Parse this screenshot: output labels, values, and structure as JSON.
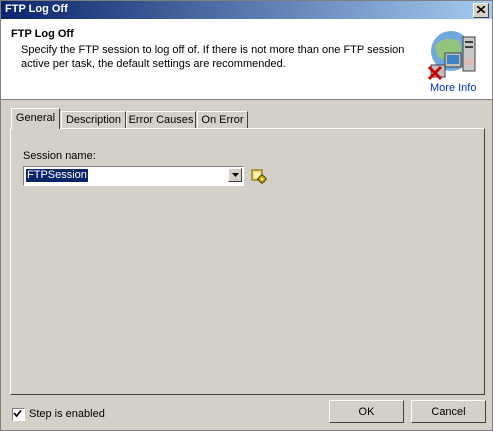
{
  "window": {
    "title": "FTP Log Off"
  },
  "header": {
    "title": "FTP Log Off",
    "description_line1": "Specify the FTP session to log off of.  If there is not more than one FTP session",
    "description_line2": "active per task, the default settings are recommended.",
    "more_info_label": "More Info"
  },
  "tabs": [
    {
      "label": "General",
      "active": true
    },
    {
      "label": "Description",
      "active": false
    },
    {
      "label": "Error Causes",
      "active": false
    },
    {
      "label": "On Error",
      "active": false
    }
  ],
  "general": {
    "session_label": "Session name:",
    "session_value": "FTPSession"
  },
  "footer": {
    "step_enabled_label": "Step is enabled",
    "step_enabled_checked": true,
    "ok_label": "OK",
    "cancel_label": "Cancel"
  },
  "colors": {
    "titlebar_start": "#0a246a",
    "titlebar_end": "#a6caf0",
    "dialog_face": "#d4d0c8",
    "link": "#0033cc"
  }
}
